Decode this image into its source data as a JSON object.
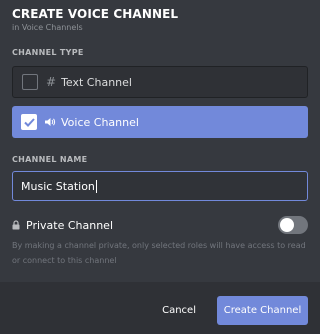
{
  "header": {
    "title": "CREATE VOICE CHANNEL",
    "subtitle": "in Voice Channels"
  },
  "channel_type": {
    "label": "CHANNEL TYPE",
    "options": [
      {
        "label": "Text Channel",
        "icon": "hash-icon",
        "selected": false
      },
      {
        "label": "Voice Channel",
        "icon": "speaker-icon",
        "selected": true
      }
    ]
  },
  "channel_name": {
    "label": "CHANNEL NAME",
    "value": "Music Station"
  },
  "private": {
    "label": "Private Channel",
    "enabled": false,
    "description": "By making a channel private, only selected roles will have access to read or connect to this channel"
  },
  "footer": {
    "cancel_label": "Cancel",
    "create_label": "Create Channel"
  },
  "colors": {
    "accent": "#7289da",
    "background": "#36393f",
    "footer": "#2f3136"
  }
}
